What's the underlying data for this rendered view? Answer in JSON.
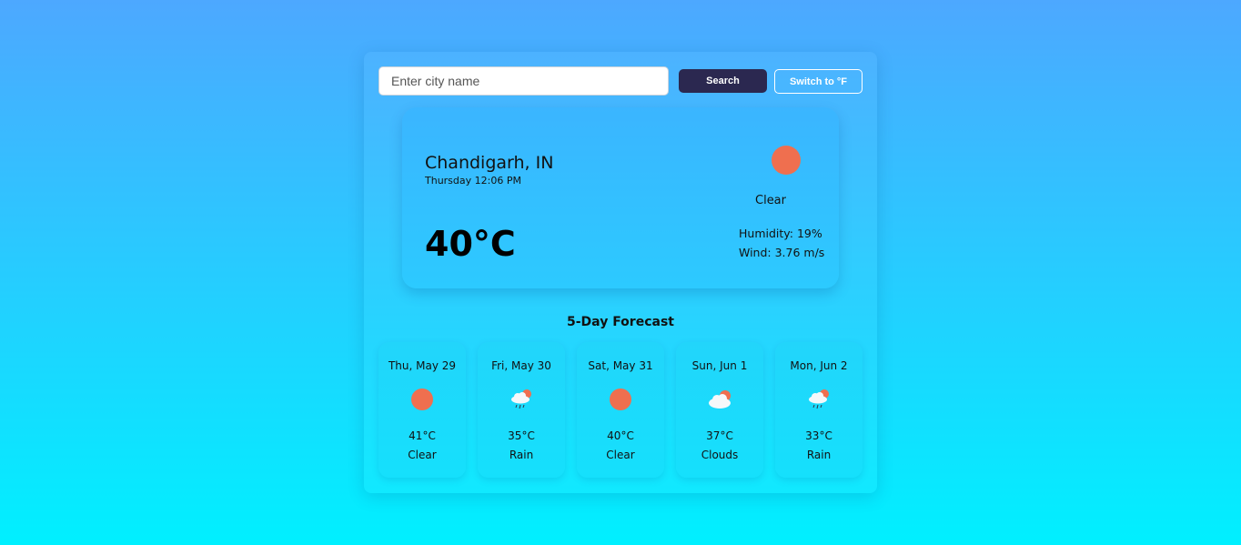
{
  "search": {
    "placeholder": "Enter city name",
    "button_label": "Search",
    "unit_toggle_label": "Switch to °F"
  },
  "current": {
    "city": "Chandigarh, IN",
    "datetime": "Thursday 12:06 PM",
    "icon": "sun-icon",
    "condition": "Clear",
    "temperature": "40°C",
    "humidity": "Humidity: 19%",
    "wind": "Wind: 3.76 m/s"
  },
  "forecast": {
    "title": "5-Day Forecast",
    "days": [
      {
        "date": "Thu, May 29",
        "icon": "sun-icon",
        "temp": "41°C",
        "condition": "Clear"
      },
      {
        "date": "Fri, May 30",
        "icon": "rain-icon",
        "temp": "35°C",
        "condition": "Rain"
      },
      {
        "date": "Sat, May 31",
        "icon": "sun-icon",
        "temp": "40°C",
        "condition": "Clear"
      },
      {
        "date": "Sun, Jun 1",
        "icon": "cloud-icon",
        "temp": "37°C",
        "condition": "Clouds"
      },
      {
        "date": "Mon, Jun 2",
        "icon": "rain-icon",
        "temp": "33°C",
        "condition": "Rain"
      }
    ]
  },
  "colors": {
    "sun": "#ef6f4f",
    "search_button": "#2b2850"
  }
}
